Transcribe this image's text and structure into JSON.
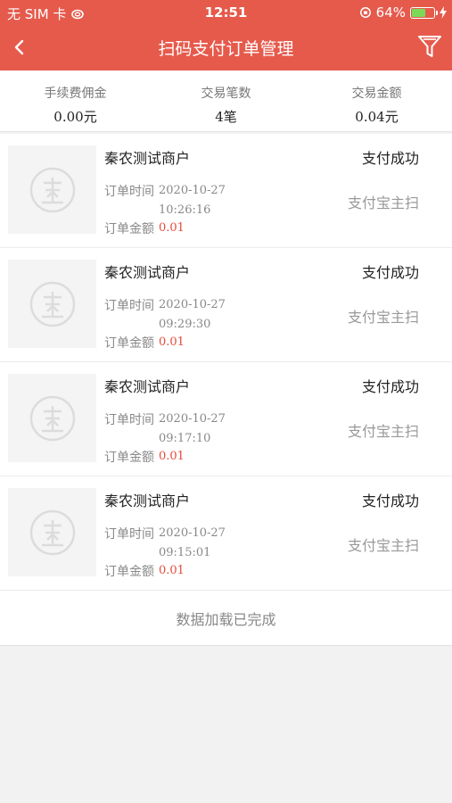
{
  "status_bar": {
    "carrier": "无 SIM 卡",
    "time": "12:51",
    "battery_percent": "64%",
    "battery_level": 0.64,
    "battery_color": "#7cd957"
  },
  "nav": {
    "title": "扫码支付订单管理",
    "back_icon": "chevron-left-icon",
    "filter_icon": "funnel-icon",
    "bg_color": "#e65a4c"
  },
  "summary": [
    {
      "label": "手续费佣金",
      "value": "0.00元"
    },
    {
      "label": "交易笔数",
      "value": "4笔"
    },
    {
      "label": "交易金额",
      "value": "0.04元"
    }
  ],
  "orders": [
    {
      "merchant": "秦农测试商户",
      "status": "支付成功",
      "method": "支付宝主扫",
      "time_label": "订单时间",
      "date": "2020-10-27",
      "time": "10:26:16",
      "amount_label": "订单金额",
      "amount": "0.01"
    },
    {
      "merchant": "秦农测试商户",
      "status": "支付成功",
      "method": "支付宝主扫",
      "time_label": "订单时间",
      "date": "2020-10-27",
      "time": "09:29:30",
      "amount_label": "订单金额",
      "amount": "0.01"
    },
    {
      "merchant": "秦农测试商户",
      "status": "支付成功",
      "method": "支付宝主扫",
      "time_label": "订单时间",
      "date": "2020-10-27",
      "time": "09:17:10",
      "amount_label": "订单金额",
      "amount": "0.01"
    },
    {
      "merchant": "秦农测试商户",
      "status": "支付成功",
      "method": "支付宝主扫",
      "time_label": "订单时间",
      "date": "2020-10-27",
      "time": "09:15:01",
      "amount_label": "订单金额",
      "amount": "0.01"
    }
  ],
  "footer": {
    "text": "数据加载已完成"
  },
  "colors": {
    "accent": "#e65a4c",
    "amount": "#e64a3c"
  }
}
